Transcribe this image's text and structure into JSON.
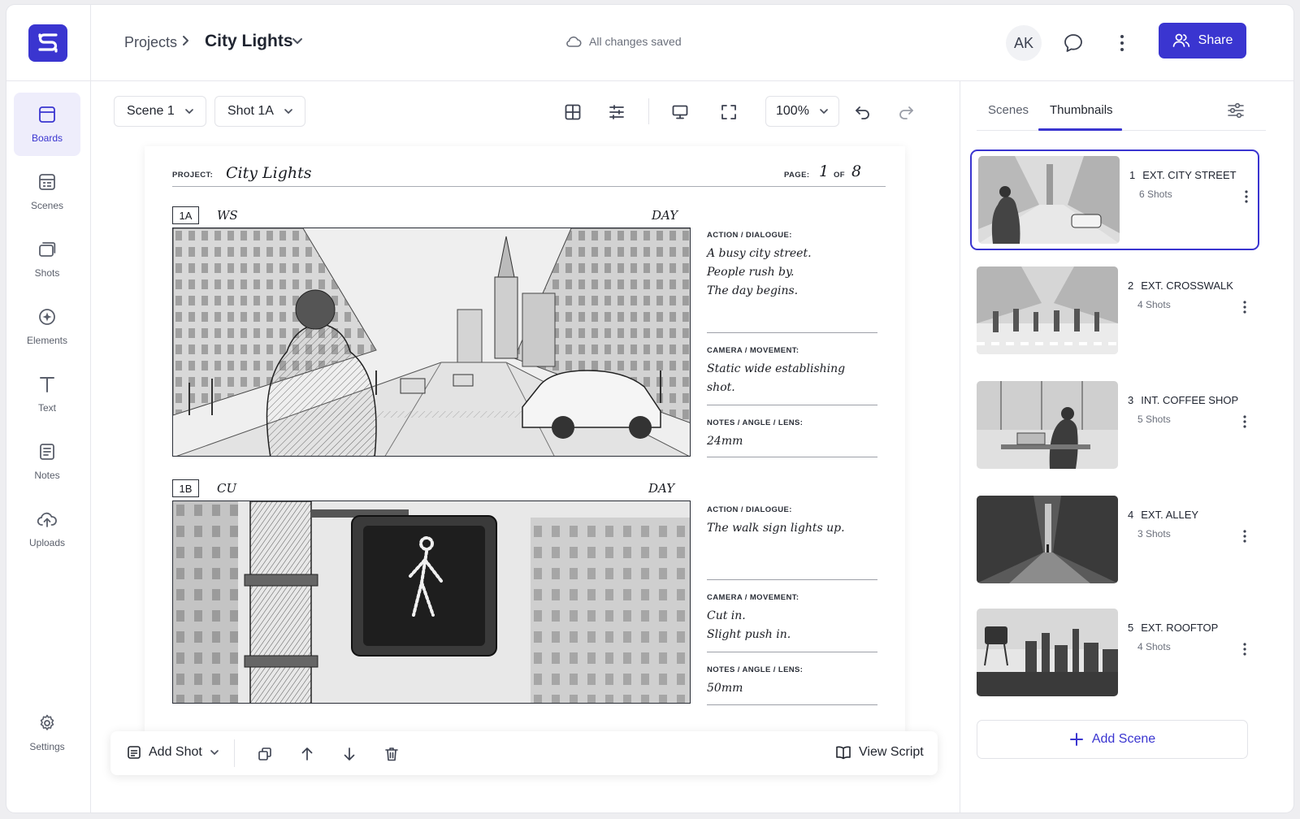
{
  "colors": {
    "accent": "#3a35d0",
    "accent_bg": "#eeedfb",
    "text": "#1f2430",
    "muted": "#6a6f7b"
  },
  "header": {
    "logo_icon": "s-logo-icon",
    "breadcrumb_root": "Projects",
    "project_title": "City Lights",
    "save_status": "All changes saved",
    "avatar_initials": "AK",
    "share_label": "Share"
  },
  "sidebar": {
    "items": [
      {
        "label": "Boards",
        "icon": "boards-icon",
        "active": true
      },
      {
        "label": "Scenes",
        "icon": "scenes-icon"
      },
      {
        "label": "Shots",
        "icon": "shots-icon"
      },
      {
        "label": "Elements",
        "icon": "elements-icon"
      },
      {
        "label": "Text",
        "icon": "text-icon"
      },
      {
        "label": "Notes",
        "icon": "notes-icon"
      },
      {
        "label": "Uploads",
        "icon": "uploads-icon"
      }
    ],
    "settings_label": "Settings"
  },
  "toolbar": {
    "scene_select": "Scene 1",
    "shot_select": "Shot 1A",
    "zoom": "100%"
  },
  "board": {
    "project_label": "PROJECT:",
    "project_name": "City Lights",
    "page_label": "PAGE:",
    "page_current": "1",
    "page_of": "OF",
    "page_total": "8",
    "shots": [
      {
        "number": "1A",
        "shot_type": "WS",
        "time": "DAY",
        "action_label": "ACTION / DIALOGUE:",
        "action_lines": [
          "A busy city street.",
          "People rush by.",
          "The day begins."
        ],
        "camera_label": "CAMERA / MOVEMENT:",
        "camera_lines": [
          "Static wide establishing",
          "shot."
        ],
        "notes_label": "NOTES / ANGLE / LENS:",
        "notes": "24mm"
      },
      {
        "number": "1B",
        "shot_type": "CU",
        "time": "DAY",
        "action_label": "ACTION / DIALOGUE:",
        "action_lines": [
          "The walk sign lights up."
        ],
        "camera_label": "CAMERA / MOVEMENT:",
        "camera_lines": [
          "Cut in.",
          "Slight push in."
        ],
        "notes_label": "NOTES / ANGLE / LENS:",
        "notes": "50mm"
      }
    ]
  },
  "bottom_bar": {
    "add_shot_label": "Add Shot",
    "view_script_label": "View Script"
  },
  "right_panel": {
    "tabs": [
      "Scenes",
      "Thumbnails"
    ],
    "active_tab": "Thumbnails",
    "scenes": [
      {
        "num": "1",
        "title": "EXT. CITY STREET",
        "shots": "6 Shots"
      },
      {
        "num": "2",
        "title": "EXT. CROSSWALK",
        "shots": "4 Shots"
      },
      {
        "num": "3",
        "title": "INT. COFFEE SHOP",
        "shots": "5 Shots"
      },
      {
        "num": "4",
        "title": "EXT. ALLEY",
        "shots": "3 Shots"
      },
      {
        "num": "5",
        "title": "EXT. ROOFTOP",
        "shots": "4 Shots"
      }
    ],
    "add_scene_label": "Add Scene"
  }
}
